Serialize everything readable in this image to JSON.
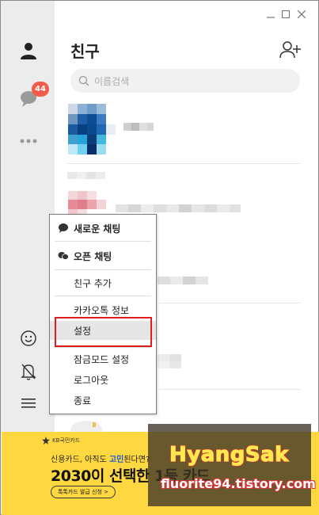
{
  "window": {
    "controls": [
      "close-icon",
      "maximize-icon",
      "minimize-icon"
    ]
  },
  "sidebar": {
    "items": [
      {
        "icon": "person-icon"
      },
      {
        "icon": "chat-bubble-icon",
        "badge": "44"
      },
      {
        "icon": "more-dots-icon"
      }
    ],
    "bottom": [
      {
        "icon": "emoji-icon"
      },
      {
        "icon": "bell-off-icon"
      },
      {
        "icon": "hamburger-menu-icon"
      }
    ]
  },
  "header": {
    "title": "친구",
    "add_friend_icon": "add-friend-icon"
  },
  "search": {
    "placeholder": "이름검색"
  },
  "menu": {
    "items": [
      {
        "label": "새로운 채팅",
        "icon": "chat-bubble-icon"
      },
      {
        "label": "오픈 채팅",
        "icon": "open-chat-icon"
      },
      {
        "label": "친구 추가"
      },
      {
        "label": "카카오톡 정보"
      },
      {
        "label": "설정"
      },
      {
        "label": "잠금모드 설정"
      },
      {
        "label": "로그아웃"
      },
      {
        "label": "종료"
      }
    ]
  },
  "banner": {
    "brand": "KB국민카드",
    "line1_pre": "신용카드, 아직도 ",
    "line1_hl": "고민",
    "line1_post": "된다면?",
    "line2": "2030이 선택한 1등 카드",
    "button": "톡톡카드 발급 신청 >"
  },
  "watermark": {
    "name": "HyangSak",
    "url": "fluorite94.tistory.com"
  },
  "colors": {
    "sidebar_bg": "#ececec",
    "badge": "#f25a4a",
    "banner_bg": "#ffd740",
    "highlight": "#e21c1c"
  }
}
